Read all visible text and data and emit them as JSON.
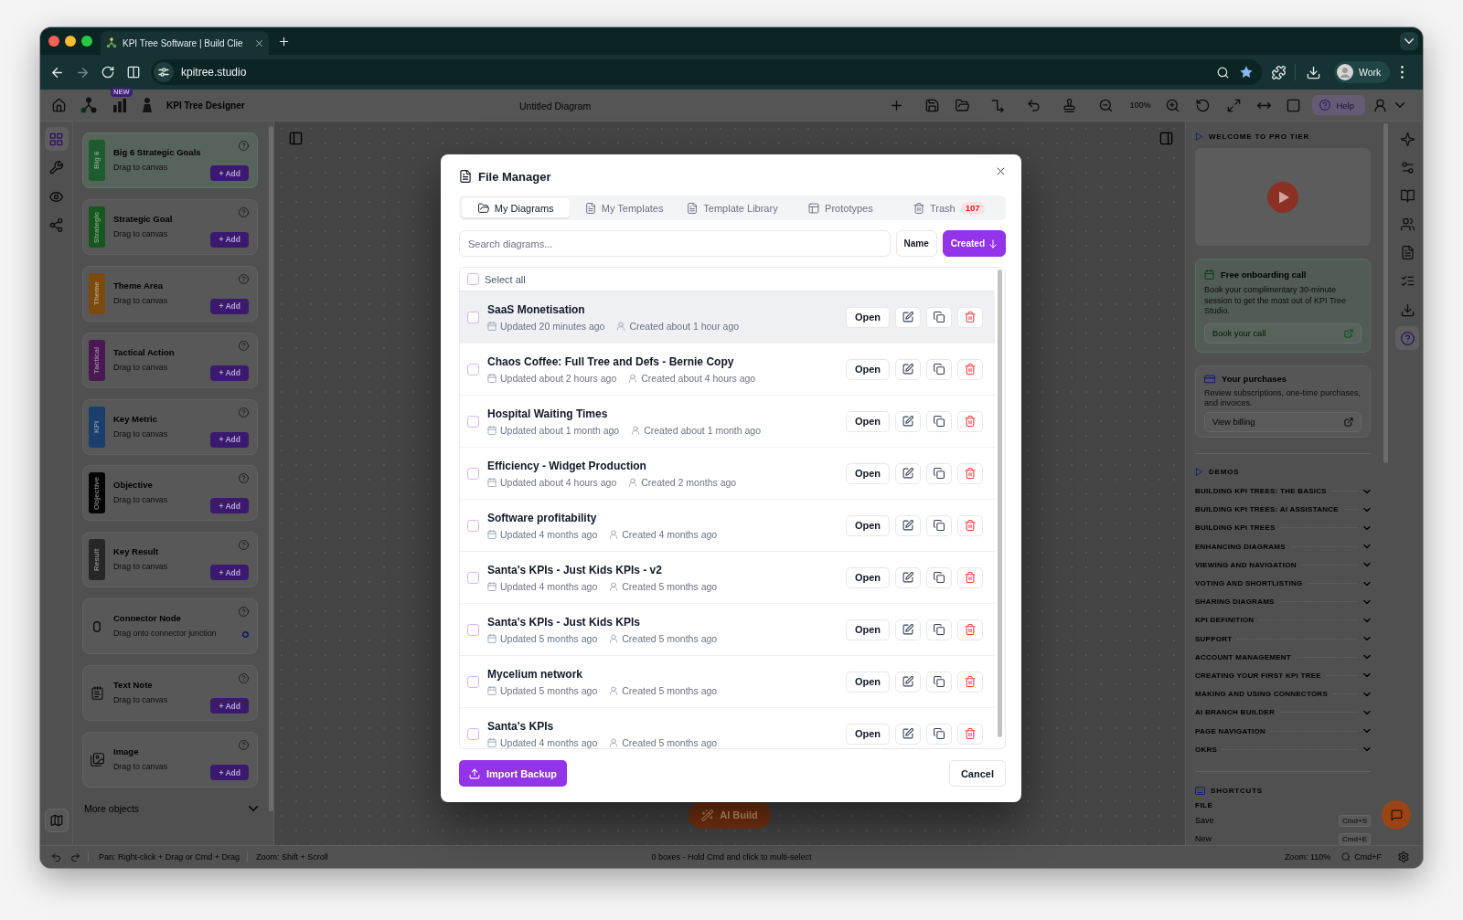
{
  "browser": {
    "tab_title": "KPI Tree Software | Build Clie",
    "url": "kpitree.studio",
    "profile": "Work"
  },
  "toolbar": {
    "new_badge": "NEW",
    "app_name": "KPI Tree Designer",
    "diagram_title": "Untitled Diagram",
    "zoom": "100%",
    "help": "Help"
  },
  "left_rail": [
    {
      "selected": true
    },
    {
      "selected": false
    },
    {
      "selected": false
    },
    {
      "selected": false
    }
  ],
  "sidebar": {
    "items": [
      {
        "kind": "tag",
        "tag": "Big 6",
        "color": "#1d5c2d",
        "title": "Big 6 Strategic Goals",
        "subtitle": "Drag to canvas",
        "action": "+ Add",
        "highlighted": true
      },
      {
        "kind": "tag",
        "tag": "Strategic",
        "color": "#17561d",
        "title": "Strategic Goal",
        "subtitle": "Drag to canvas",
        "action": "+ Add",
        "highlighted": false
      },
      {
        "kind": "tag",
        "tag": "Theme",
        "color": "#7b4a0d",
        "title": "Theme Area",
        "subtitle": "Drag to canvas",
        "action": "+ Add",
        "highlighted": false
      },
      {
        "kind": "tag",
        "tag": "Tactical",
        "color": "#4a1852",
        "title": "Tactical Action",
        "subtitle": "Drag to canvas",
        "action": "+ Add",
        "highlighted": false
      },
      {
        "kind": "tag",
        "tag": "KPI",
        "color": "#1b3e6c",
        "title": "Key Metric",
        "subtitle": "Drag to canvas",
        "action": "+ Add",
        "highlighted": false
      },
      {
        "kind": "tag",
        "tag": "Objective",
        "color": "#050505",
        "title": "Objective",
        "subtitle": "Drag to canvas",
        "action": "+ Add",
        "highlighted": false
      },
      {
        "kind": "tag",
        "tag": "Result",
        "color": "#272727",
        "title": "Key Result",
        "subtitle": "Drag to canvas",
        "action": "+ Add",
        "highlighted": false
      },
      {
        "kind": "connector",
        "title": "Connector Node",
        "subtitle": "Drag onto connector junction",
        "highlighted": false
      },
      {
        "kind": "note",
        "title": "Text Note",
        "subtitle": "Drag to canvas",
        "action": "+ Add",
        "highlighted": false
      },
      {
        "kind": "image",
        "title": "Image",
        "subtitle": "Drag to canvas",
        "action": "+ Add",
        "highlighted": false
      }
    ],
    "more": "More objects"
  },
  "canvas": {
    "ai_button": "AI Build"
  },
  "help_panel": {
    "welcome": "WELCOME TO PRO TIER",
    "onboarding": {
      "title": "Free onboarding call",
      "text": "Book your complimentary 30-minute session to get the most out of KPI Tree Studio.",
      "button": "Book your call"
    },
    "purchases": {
      "title": "Your purchases",
      "text": "Review subscriptions, one-time purchases, and invoices.",
      "button": "View billing"
    },
    "demos_title": "DEMOS",
    "demos": [
      {
        "label": "BUILDING KPI TREES: THE BASICS",
        "expanded": false
      },
      {
        "label": "BUILDING KPI TREES: AI ASSISTANCE",
        "expanded": false
      },
      {
        "label": "BUILDING KPI TREES",
        "expanded": false
      },
      {
        "label": "ENHANCING DIAGRAMS",
        "expanded": false
      },
      {
        "label": "VIEWING AND NAVIGATION",
        "expanded": false
      },
      {
        "label": "VOTING AND SHORTLISTING",
        "expanded": false
      },
      {
        "label": "SHARING DIAGRAMS",
        "expanded": false
      },
      {
        "label": "KPI DEFINITION",
        "expanded": false
      },
      {
        "label": "SUPPORT",
        "expanded": false
      },
      {
        "label": "ACCOUNT MANAGEMENT",
        "expanded": false
      },
      {
        "label": "CREATING YOUR FIRST KPI TREE",
        "expanded": false
      },
      {
        "label": "MAKING AND USING CONNECTORS",
        "expanded": false
      },
      {
        "label": "AI BRANCH BUILDER",
        "expanded": false
      },
      {
        "label": "PAGE NAVIGATION",
        "expanded": false
      },
      {
        "label": "OKRS",
        "expanded": false
      }
    ],
    "shortcuts_title": "SHORTCUTS",
    "shortcut_group": "FILE",
    "shortcuts": [
      {
        "label": "Save",
        "keys": "Cmd+S"
      },
      {
        "label": "New",
        "keys": "Cmd+E"
      }
    ]
  },
  "right_rail": [
    {
      "selected": false
    },
    {
      "selected": false
    },
    {
      "selected": false
    },
    {
      "selected": false
    },
    {
      "selected": false
    },
    {
      "selected": false
    },
    {
      "selected": false
    },
    {
      "selected": true
    }
  ],
  "status_bar": {
    "pan_hint": "Pan: Right-click + Drag or Cmd + Drag",
    "zoom_hint": "Zoom: Shift + Scroll",
    "selection": "0 boxes - Hold Cmd and click to multi-select",
    "zoom": "Zoom: 110%",
    "search_keys": "Cmd+F"
  },
  "file_manager": {
    "title": "File Manager",
    "tabs": [
      {
        "label": "My Diagrams",
        "selected": true
      },
      {
        "label": "My Templates",
        "selected": false
      },
      {
        "label": "Template Library",
        "selected": false
      },
      {
        "label": "Prototypes",
        "selected": false
      },
      {
        "label": "Trash",
        "selected": false,
        "badge": "107"
      }
    ],
    "search": {
      "placeholder": "Search diagrams..."
    },
    "sort_buttons": [
      {
        "label": "Name",
        "selected": false
      },
      {
        "label": "Created",
        "selected": true
      }
    ],
    "select_all": {
      "label": "Select all",
      "checked": false
    },
    "rows": [
      {
        "name": "SaaS Monetisation",
        "updated": "Updated 20 minutes ago",
        "created": "Created about 1 hour ago",
        "action": "Open",
        "checked": false,
        "highlighted": true
      },
      {
        "name": "Chaos Coffee: Full Tree and Defs - Bernie Copy",
        "updated": "Updated about 2 hours ago",
        "created": "Created about 4 hours ago",
        "action": "Open",
        "checked": false,
        "highlighted": false
      },
      {
        "name": "Hospital Waiting Times",
        "updated": "Updated about 1 month ago",
        "created": "Created about 1 month ago",
        "action": "Open",
        "checked": false,
        "highlighted": false
      },
      {
        "name": "Efficiency - Widget Production",
        "updated": "Updated about 4 hours ago",
        "created": "Created 2 months ago",
        "action": "Open",
        "checked": false,
        "highlighted": false
      },
      {
        "name": "Software profitability",
        "updated": "Updated 4 months ago",
        "created": "Created 4 months ago",
        "action": "Open",
        "checked": false,
        "highlighted": false
      },
      {
        "name": "Santa's KPIs - Just Kids KPIs - v2",
        "updated": "Updated 4 months ago",
        "created": "Created 5 months ago",
        "action": "Open",
        "checked": false,
        "highlighted": false
      },
      {
        "name": "Santa's KPIs - Just Kids KPIs",
        "updated": "Updated 5 months ago",
        "created": "Created 5 months ago",
        "action": "Open",
        "checked": false,
        "highlighted": false
      },
      {
        "name": "Mycelium network",
        "updated": "Updated 5 months ago",
        "created": "Created 5 months ago",
        "action": "Open",
        "checked": false,
        "highlighted": false
      },
      {
        "name": "Santa's KPIs",
        "updated": "Updated 4 months ago",
        "created": "Created 5 months ago",
        "action": "Open",
        "checked": false,
        "highlighted": false
      }
    ],
    "import_button": "Import Backup",
    "cancel_button": "Cancel"
  }
}
